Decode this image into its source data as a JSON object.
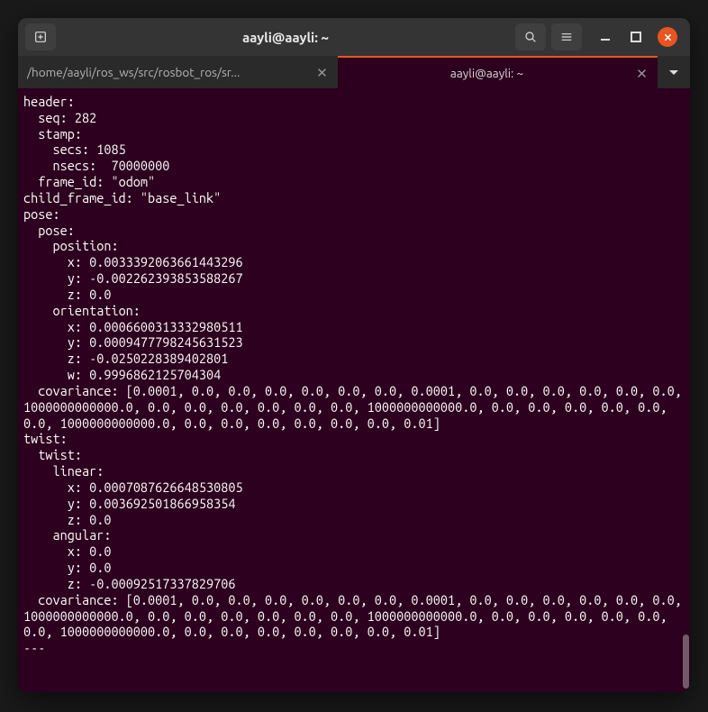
{
  "titlebar": {
    "title": "aayli@aayli: ~"
  },
  "tabs": {
    "t1": "/home/aayli/ros_ws/src/rosbot_ros/sr...",
    "t2": "aayli@aayli: ~"
  },
  "terminal": {
    "content": "header:\n  seq: 282\n  stamp:\n    secs: 1085\n    nsecs:  70000000\n  frame_id: \"odom\"\nchild_frame_id: \"base_link\"\npose:\n  pose:\n    position:\n      x: 0.0033392063661443296\n      y: -0.002262393853588267\n      z: 0.0\n    orientation:\n      x: 0.0006600313332980511\n      y: 0.0009477798245631523\n      z: -0.0250228389402801\n      w: 0.9996862125704304\n  covariance: [0.0001, 0.0, 0.0, 0.0, 0.0, 0.0, 0.0, 0.0001, 0.0, 0.0, 0.0, 0.0, 0.0, 0.0, 1000000000000.0, 0.0, 0.0, 0.0, 0.0, 0.0, 0.0, 1000000000000.0, 0.0, 0.0, 0.0, 0.0, 0.0, 0.0, 1000000000000.0, 0.0, 0.0, 0.0, 0.0, 0.0, 0.0, 0.01]\ntwist:\n  twist:\n    linear:\n      x: 0.0007087626648530805\n      y: 0.003692501866958354\n      z: 0.0\n    angular:\n      x: 0.0\n      y: 0.0\n      z: -0.00092517337829706\n  covariance: [0.0001, 0.0, 0.0, 0.0, 0.0, 0.0, 0.0, 0.0001, 0.0, 0.0, 0.0, 0.0, 0.0, 0.0, 1000000000000.0, 0.0, 0.0, 0.0, 0.0, 0.0, 0.0, 1000000000000.0, 0.0, 0.0, 0.0, 0.0, 0.0, 0.0, 1000000000000.0, 0.0, 0.0, 0.0, 0.0, 0.0, 0.0, 0.01]\n---"
  }
}
